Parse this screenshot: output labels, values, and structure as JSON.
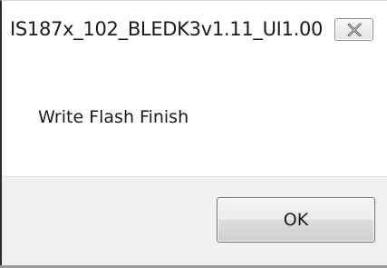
{
  "window": {
    "title": "IS187x_102_BLEDK3v1.11_UI1.00"
  },
  "message": {
    "text": "Write Flash Finish"
  },
  "buttons": {
    "ok_label": "OK",
    "close_icon": "close-icon"
  }
}
